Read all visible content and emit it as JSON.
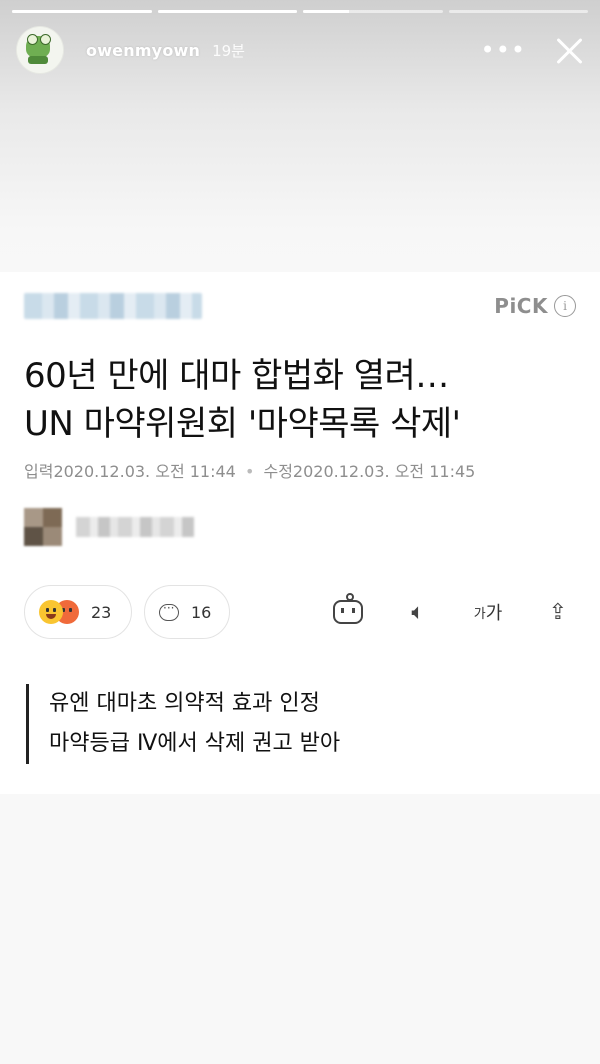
{
  "story": {
    "username": "owenmyown",
    "time_ago": "19분",
    "more_icon": "more-horizontal-icon",
    "close_icon": "close-icon",
    "progress": [
      1,
      1,
      0.33,
      0
    ]
  },
  "article": {
    "pick_label": "PiCK",
    "info_symbol": "i",
    "headline_lines": [
      "60년 만에 대마 합법화 열려…",
      "UN 마약위원회 '마약목록 삭제'"
    ],
    "published": "입력2020.12.03. 오전 11:44",
    "date_separator": "•",
    "updated": "수정2020.12.03. 오전 11:45",
    "reaction_count": "23",
    "comment_count": "16",
    "font_size_label_small": "가",
    "font_size_label_large": "가",
    "subhead_lines": [
      "유엔 대마초 의약적 효과 인정",
      "마약등급 Ⅳ에서 삭제 권고 받아"
    ]
  }
}
